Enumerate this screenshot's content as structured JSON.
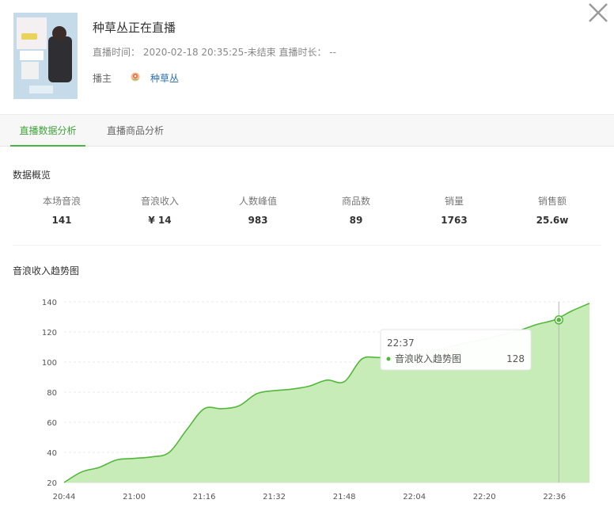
{
  "live": {
    "title": "种草丛正在直播",
    "time_label": "直播时间：",
    "time_value": "2020-02-18 20:35:25-未结束",
    "duration_label": "直播时长：",
    "duration_value": "--",
    "host_label": "播主",
    "host_name": "种草丛"
  },
  "tabs": [
    {
      "label": "直播数据分析",
      "active": true
    },
    {
      "label": "直播商品分析",
      "active": false
    }
  ],
  "overview": {
    "title": "数据概览",
    "stats": [
      {
        "label": "本场音浪",
        "value": "141"
      },
      {
        "label": "音浪收入",
        "value": "¥ 14"
      },
      {
        "label": "人数峰值",
        "value": "983"
      },
      {
        "label": "商品数",
        "value": "89"
      },
      {
        "label": "销量",
        "value": "1763"
      },
      {
        "label": "销售额",
        "value": "25.6w"
      }
    ]
  },
  "trend": {
    "title": "音浪收入趋势图"
  },
  "colors": {
    "accent": "#4bb542",
    "area_fill": "#c8ecb8",
    "line": "#52b83a",
    "link": "#2c6fb0"
  },
  "chart_data": {
    "type": "area",
    "x_tick_labels": [
      "20:44",
      "21:00",
      "21:16",
      "21:32",
      "21:48",
      "22:04",
      "22:20",
      "22:36"
    ],
    "y_ticks": [
      20,
      40,
      60,
      80,
      100,
      120,
      140
    ],
    "ylim": [
      20,
      140
    ],
    "grid": true,
    "series": [
      {
        "name": "音浪收入趋势图",
        "x": [
          "20:44",
          "20:48",
          "20:52",
          "20:56",
          "21:00",
          "21:04",
          "21:08",
          "21:12",
          "21:16",
          "21:20",
          "21:24",
          "21:28",
          "21:32",
          "21:36",
          "21:40",
          "21:44",
          "21:48",
          "21:52",
          "21:56",
          "22:00",
          "22:04",
          "22:08",
          "22:12",
          "22:16",
          "22:20",
          "22:24",
          "22:28",
          "22:32",
          "22:36",
          "22:40",
          "22:44"
        ],
        "values": [
          20,
          27,
          30,
          35,
          36,
          37,
          40,
          55,
          69,
          69,
          71,
          79,
          81,
          82,
          84,
          88,
          87,
          102,
          103,
          104,
          104,
          107,
          110,
          113,
          115,
          118,
          121,
          125,
          128,
          134,
          139
        ]
      }
    ],
    "tooltip": {
      "x": "22:37",
      "series": "音浪收入趋势图",
      "value": 128
    }
  }
}
